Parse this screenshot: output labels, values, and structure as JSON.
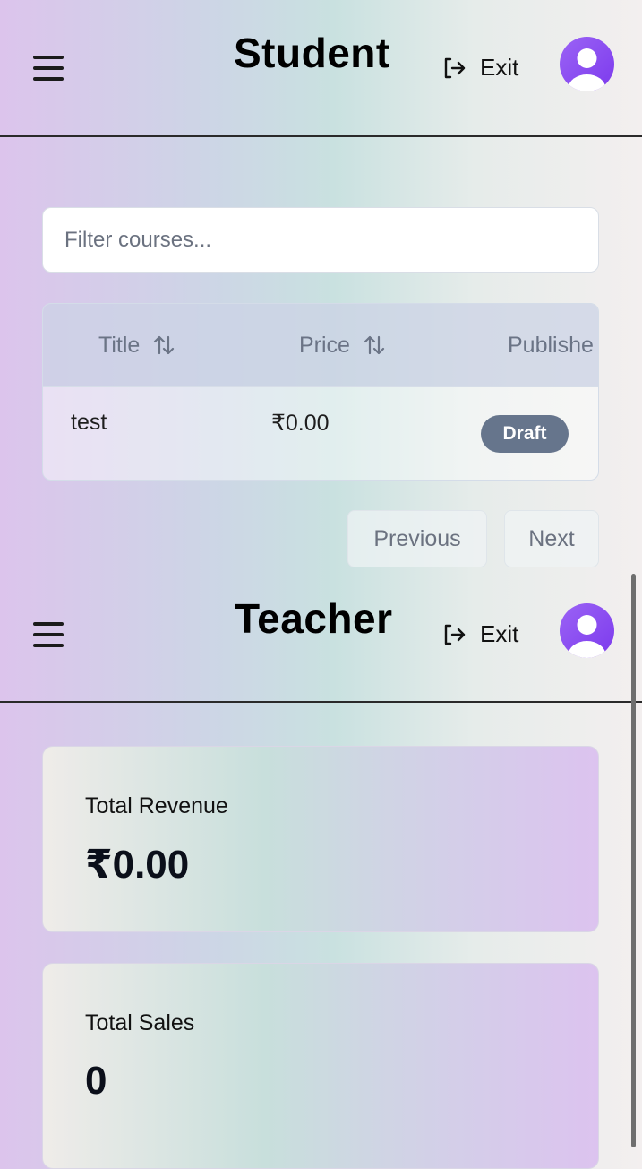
{
  "student": {
    "title": "Student",
    "exit_label": "Exit",
    "filter": {
      "placeholder": "Filter courses..."
    },
    "table": {
      "columns": [
        "Title",
        "Price",
        "Publishe"
      ],
      "rows": [
        {
          "title": "test",
          "price": "₹0.00",
          "status": "Draft"
        }
      ]
    },
    "pagination": {
      "previous": "Previous",
      "next": "Next"
    }
  },
  "teacher": {
    "title": "Teacher",
    "exit_label": "Exit",
    "stats": [
      {
        "label": "Total Revenue",
        "value": "₹0.00"
      },
      {
        "label": "Total Sales",
        "value": "0"
      }
    ]
  },
  "icons": {
    "menu": "menu-icon",
    "exit": "log-out-icon",
    "avatar": "user-avatar-icon",
    "sort": "sort-arrows-icon"
  },
  "colors": {
    "avatar": "#8b4cf6",
    "badge_draft": "#66758c",
    "divider": "#2a2a2a"
  }
}
